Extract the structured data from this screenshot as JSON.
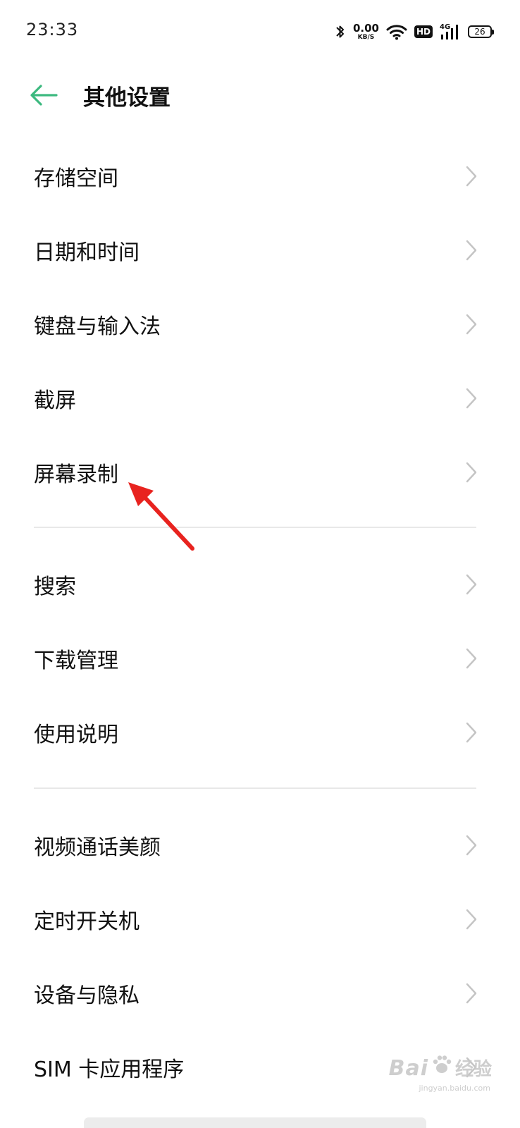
{
  "status_bar": {
    "time": "23:33",
    "net_speed_value": "0.00",
    "net_speed_unit": "KB/S",
    "hd_label": "HD",
    "network_type": "4G",
    "battery_level": "26",
    "icons": [
      "bluetooth-icon",
      "wifi-icon",
      "hd-icon",
      "signal-icon",
      "battery-icon"
    ]
  },
  "header": {
    "title": "其他设置",
    "back_icon": "arrow-left-icon",
    "accent_color": "#3cb97f"
  },
  "groups": [
    {
      "items": [
        {
          "label": "存储空间"
        },
        {
          "label": "日期和时间"
        },
        {
          "label": "键盘与输入法"
        },
        {
          "label": "截屏"
        },
        {
          "label": "屏幕录制"
        }
      ]
    },
    {
      "items": [
        {
          "label": "搜索"
        },
        {
          "label": "下载管理"
        },
        {
          "label": "使用说明"
        }
      ]
    },
    {
      "items": [
        {
          "label": "视频通话美颜"
        },
        {
          "label": "定时开关机"
        },
        {
          "label": "设备与隐私"
        },
        {
          "label": "SIM 卡应用程序"
        }
      ]
    }
  ],
  "annotation": {
    "target": "屏幕录制",
    "color": "#e8231f"
  },
  "watermark": {
    "brand": "Bai",
    "brand_cn": "经验",
    "site": "jingyan.baidu.com"
  }
}
